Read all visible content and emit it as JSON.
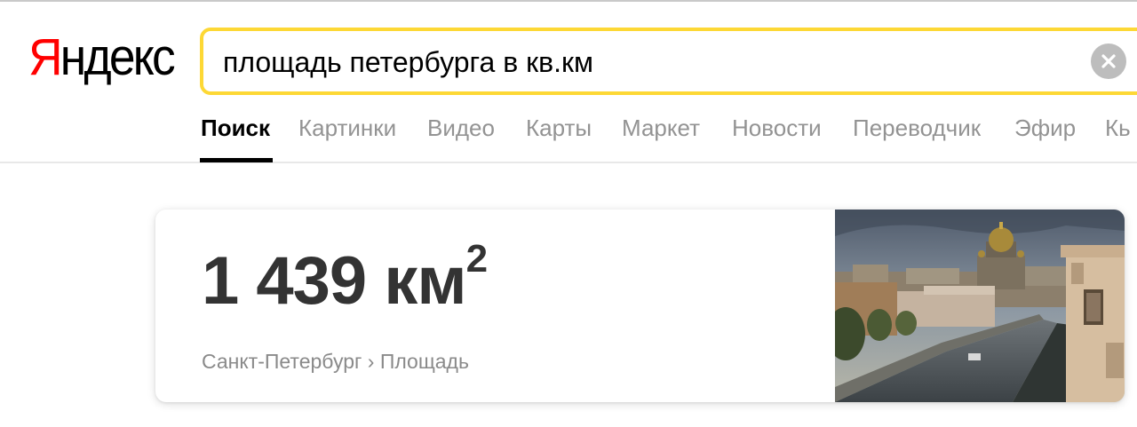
{
  "logo": {
    "first_letter": "Я",
    "rest": "ндекс"
  },
  "search": {
    "query": "площадь петербурга в кв.км"
  },
  "tabs": [
    {
      "label": "Поиск",
      "active": true
    },
    {
      "label": "Картинки"
    },
    {
      "label": "Видео"
    },
    {
      "label": "Карты"
    },
    {
      "label": "Маркет"
    },
    {
      "label": "Новости"
    },
    {
      "label": "Переводчик"
    },
    {
      "label": "Эфир"
    },
    {
      "label": "Кь"
    }
  ],
  "answer": {
    "value": "1 439 км",
    "superscript": "2",
    "breadcrumb_city": "Санкт-Петербург",
    "breadcrumb_sep": "›",
    "breadcrumb_topic": "Площадь"
  },
  "colors": {
    "logo_red": "#ff0000",
    "search_border": "#fdd835",
    "tab_inactive": "#939393",
    "answer_text": "#333333"
  },
  "icons": {
    "clear": "close-icon"
  }
}
